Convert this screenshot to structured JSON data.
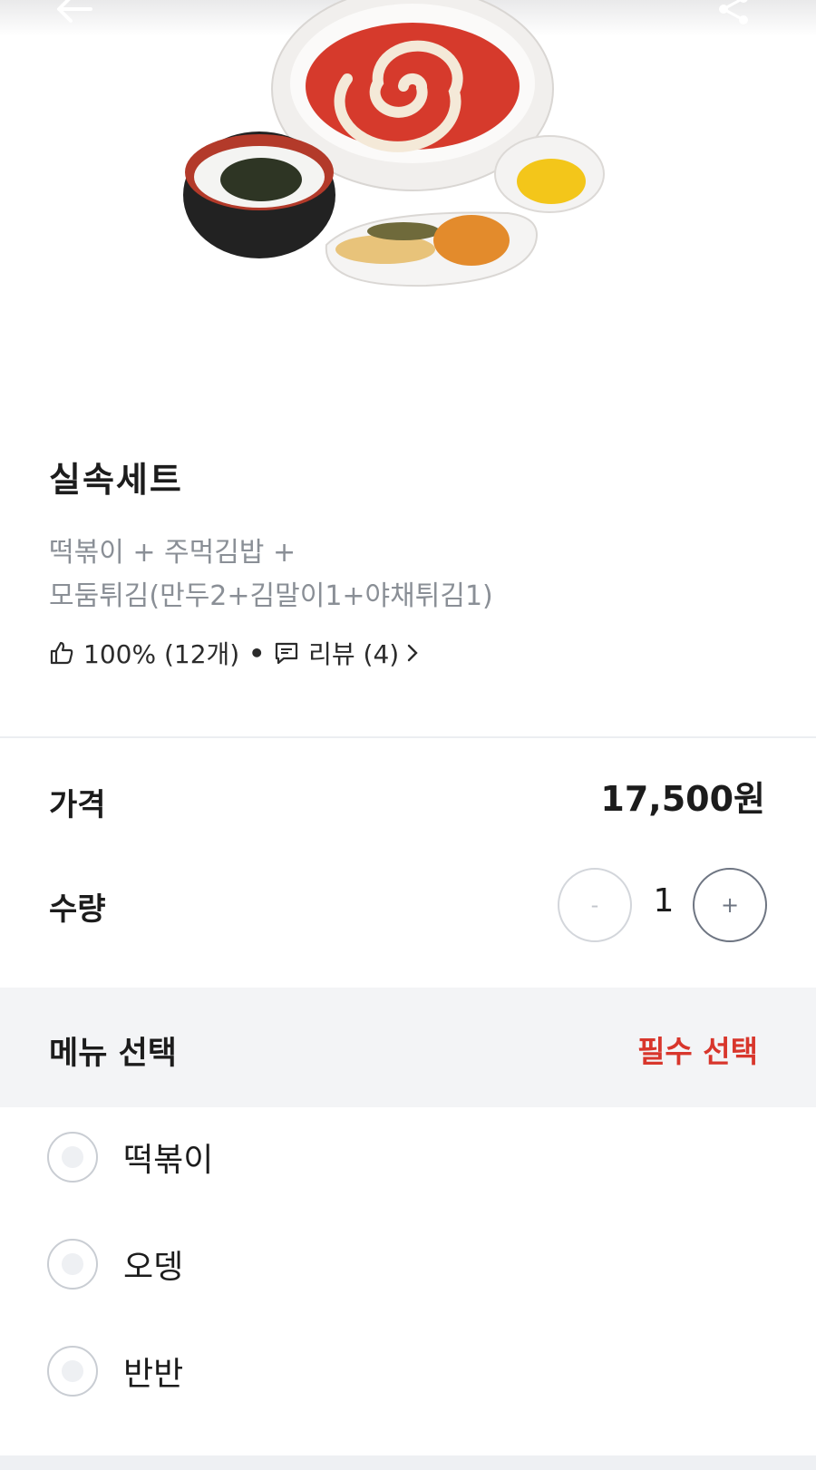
{
  "header": {
    "back_icon": "arrow-left-icon",
    "share_icon": "share-icon"
  },
  "product": {
    "title": "실속세트",
    "description_line1": "떡볶이 + 주먹김밥 +",
    "description_line2": "모둠튀김(만두2+김말이1+야채튀김1)",
    "like_icon": "thumbs-up-icon",
    "like_rate": "100% (12개)",
    "separator": "•",
    "review_icon": "comment-icon",
    "review_text": "리뷰 (4)"
  },
  "price": {
    "label": "가격",
    "value": "17,500원"
  },
  "quantity": {
    "label": "수량",
    "minus_label": "-",
    "plus_label": "+",
    "value": "1"
  },
  "menu_select": {
    "title": "메뉴 선택",
    "badge": "필수 선택",
    "badge_color": "#d8362c",
    "options": [
      {
        "label": "떡볶이",
        "selected": false
      },
      {
        "label": "오뎅",
        "selected": false
      },
      {
        "label": "반반",
        "selected": false
      }
    ]
  }
}
